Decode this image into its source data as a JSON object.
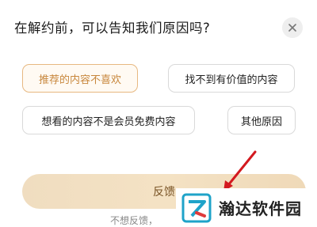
{
  "dialog": {
    "title": "在解约前，可以告知我们原因吗?",
    "close_icon": "close-icon"
  },
  "reasons": [
    {
      "label": "推荐的内容不喜欢",
      "selected": true
    },
    {
      "label": "找不到有价值的内容",
      "selected": false
    },
    {
      "label": "想看的内容不是会员免费内容",
      "selected": false
    },
    {
      "label": "其他原因",
      "selected": false
    }
  ],
  "actions": {
    "feedback_label": "反馈",
    "skip_label": "不想反馈，"
  },
  "colors": {
    "selected_border": "#e7b881",
    "selected_text": "#c8873c",
    "button_gradient_start": "#f0ddc0",
    "arrow": "#d3191f"
  },
  "watermark": {
    "text": "瀚达软件园",
    "logo_icon": "watermark-logo-icon"
  }
}
